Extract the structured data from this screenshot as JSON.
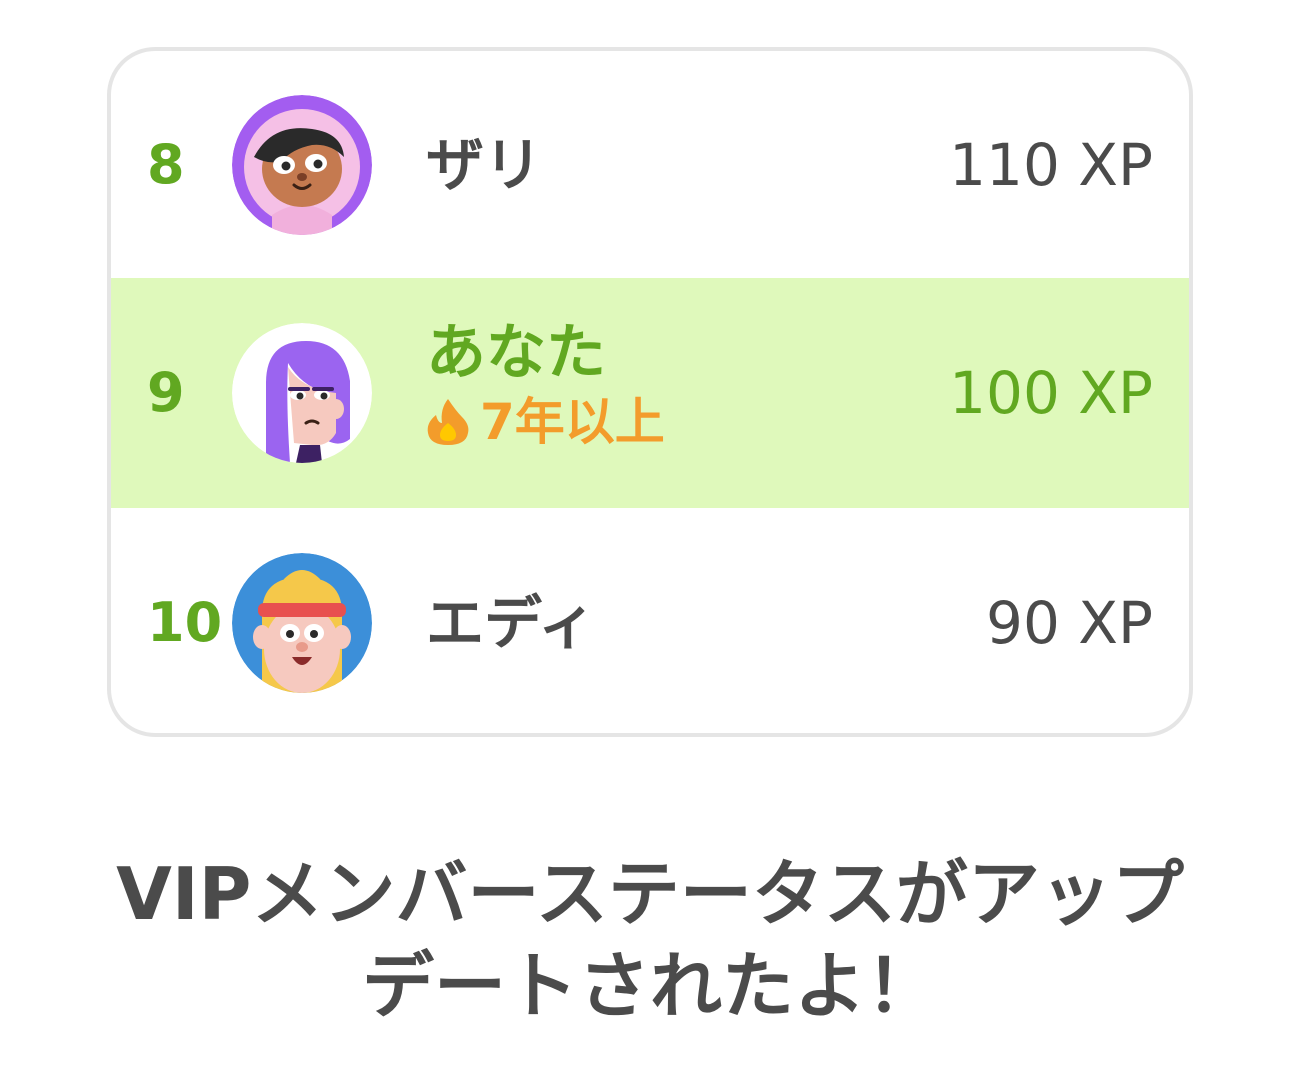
{
  "leaderboard": {
    "rows": [
      {
        "rank": "8",
        "name": "ザリ",
        "xp": "110 XP",
        "avatar_icon": "zari-avatar-icon"
      },
      {
        "rank": "9",
        "name": "あなた",
        "streak": "7年以上",
        "xp": "100 XP",
        "avatar_icon": "user-avatar-icon",
        "highlighted": true
      },
      {
        "rank": "10",
        "name": "エディ",
        "xp": "90 XP",
        "avatar_icon": "eddy-avatar-icon"
      }
    ]
  },
  "headline": {
    "line1": "VIPメンバーステータスがアップ",
    "line2": "デートされたよ！"
  },
  "colors": {
    "rank_green": "#61a821",
    "highlight_bg": "#dff9bb",
    "streak_orange": "#f39c2b",
    "text_dark": "#4b4b4b",
    "card_border": "#e5e5e5"
  }
}
